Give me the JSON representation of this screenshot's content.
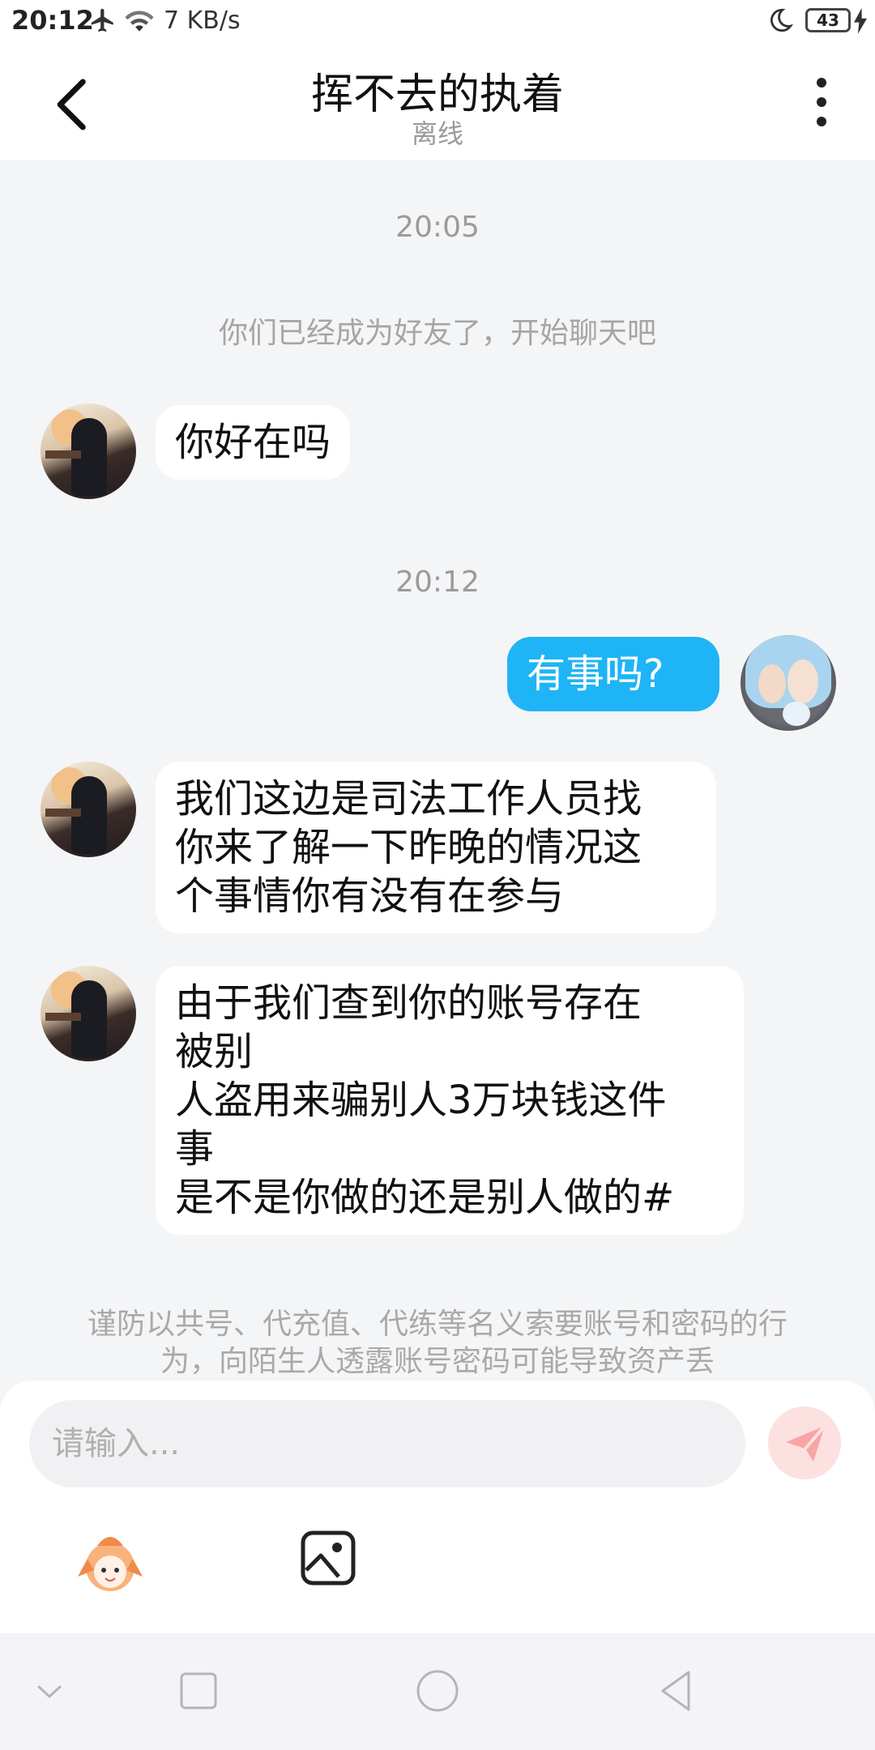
{
  "status_bar": {
    "time": "20:12",
    "net_speed": "7 KB/s",
    "battery": "43",
    "icons": [
      "airplane-icon",
      "wifi-icon",
      "moon-icon",
      "battery-icon",
      "charging-icon"
    ]
  },
  "header": {
    "title": "挥不去的执着",
    "status": "离线",
    "back_icon": "chevron-left-icon",
    "more_icon": "more-vertical-icon"
  },
  "chat": {
    "timestamps": [
      "20:05",
      "20:12"
    ],
    "system_message": "你们已经成为好友了，开始聊天吧",
    "messages": [
      {
        "sender": "other",
        "text": "你好在吗"
      },
      {
        "sender": "me",
        "text": "有事吗?"
      },
      {
        "sender": "other",
        "text": "我们这边是司法工作人员找\n你来了解一下昨晚的情况这\n个事情你有没有在参与"
      },
      {
        "sender": "other",
        "text": "由于我们查到你的账号存在\n被别\n人盗用来骗别人3万块钱这件\n事\n是不是你做的还是别人做的#"
      }
    ],
    "warning": "谨防以共号、代充值、代练等名义索要账号和密码的行为，向陌生人透露账号密码可能导致资产丢"
  },
  "input": {
    "placeholder": "请输入...",
    "send_icon": "send-icon",
    "emoji_icon": "emoji-sticker-icon",
    "image_icon": "image-icon",
    "colors": {
      "send_bg": "#fde1e1",
      "send_fg": "#f8a5a5"
    }
  },
  "nav_bar": {
    "icons": [
      "collapse-down-icon",
      "recents-square-icon",
      "home-circle-icon",
      "back-triangle-icon"
    ]
  },
  "colors": {
    "accent_bubble": "#1fb4f6",
    "background": "#f4f5f7"
  }
}
